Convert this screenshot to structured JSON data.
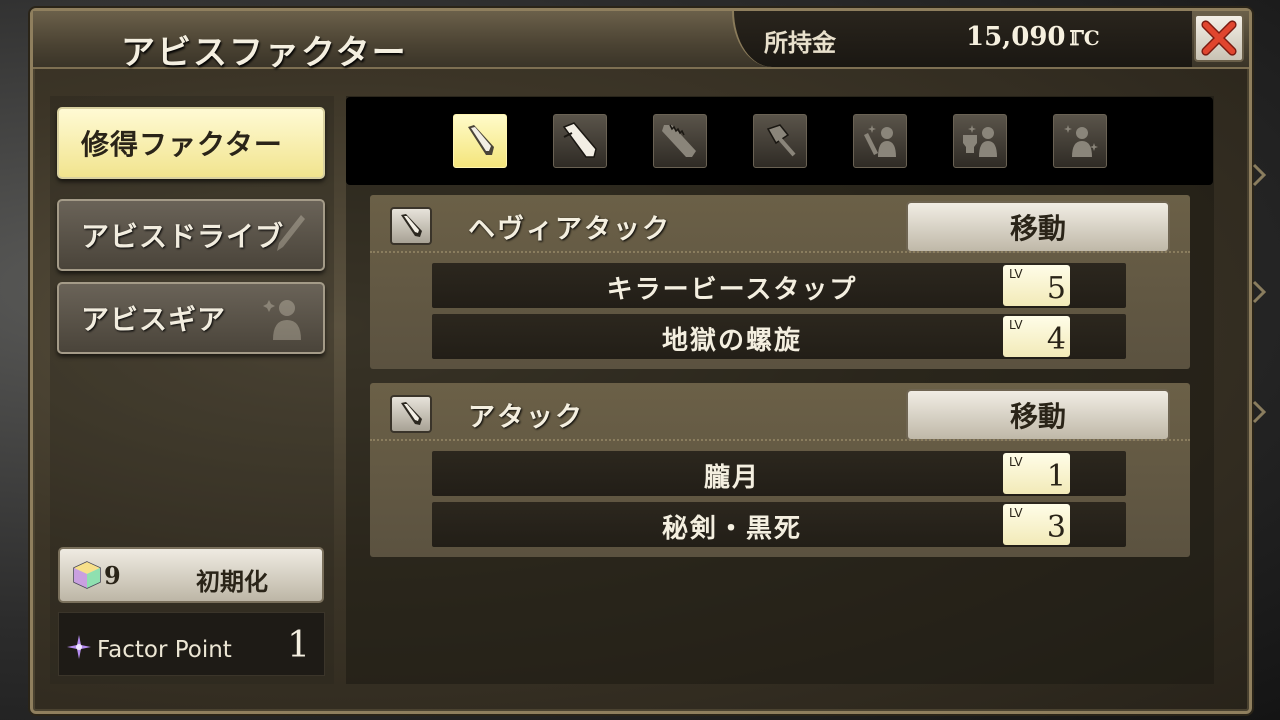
{
  "window": {
    "title": "アビスファクター"
  },
  "money": {
    "label": "所持金",
    "value": "15,090",
    "unit": "ℾC"
  },
  "close": {
    "icon": "close-x-icon"
  },
  "sidebar": {
    "items": [
      {
        "label": "修得ファクター",
        "active": true
      },
      {
        "label": "アビスドライブ",
        "active": false
      },
      {
        "label": "アビスギア",
        "active": false
      }
    ],
    "reset": {
      "count": "9",
      "label": "初期化"
    },
    "factor_point": {
      "label": "Factor Point",
      "value": "1"
    }
  },
  "tabs": [
    {
      "icon": "sword-icon",
      "active": true
    },
    {
      "icon": "great-sword-icon",
      "active": false
    },
    {
      "icon": "serrated-blade-icon",
      "active": false
    },
    {
      "icon": "hammer-icon",
      "active": false
    },
    {
      "icon": "sword-person-icon",
      "active": false
    },
    {
      "icon": "armor-person-icon",
      "active": false
    },
    {
      "icon": "sparkle-person-icon",
      "active": false
    }
  ],
  "groups": [
    {
      "name": "ヘヴィアタック",
      "move_label": "移動",
      "skills": [
        {
          "name": "キラービースタップ",
          "lv_label": "LV",
          "lv": "5"
        },
        {
          "name": "地獄の螺旋",
          "lv_label": "LV",
          "lv": "4"
        }
      ]
    },
    {
      "name": "アタック",
      "move_label": "移動",
      "skills": [
        {
          "name": "朧月",
          "lv_label": "LV",
          "lv": "1"
        },
        {
          "name": "秘剣・黒死",
          "lv_label": "LV",
          "lv": "3"
        }
      ]
    }
  ],
  "colors": {
    "active_yellow": "#f4e57c",
    "close_red": "#d2402c",
    "panel_brown": "#5b5240"
  }
}
